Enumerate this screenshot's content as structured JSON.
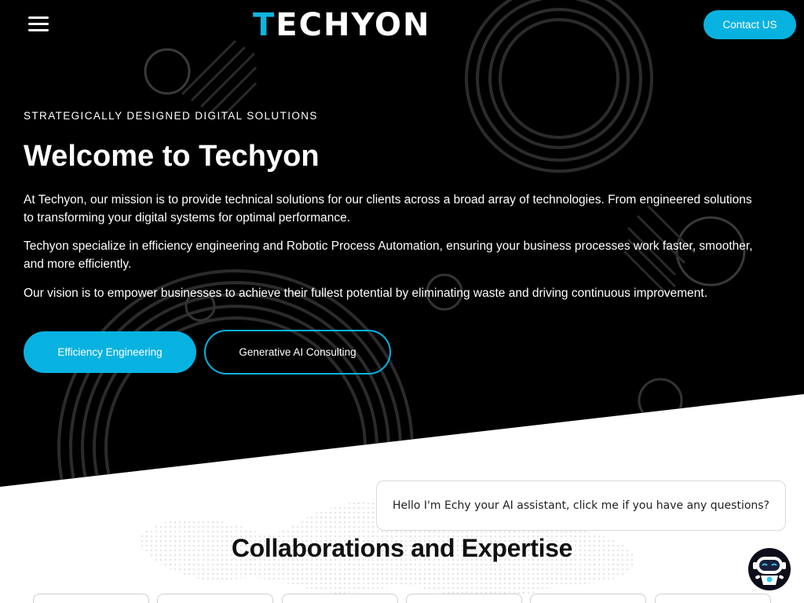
{
  "header": {
    "menu_icon": "hamburger-menu-icon",
    "logo_accent": "T",
    "logo_rest": "ECHYON",
    "contact_label": "Contact US"
  },
  "hero": {
    "eyebrow": "STRATEGICALLY DESIGNED DIGITAL SOLUTIONS",
    "title": "Welcome to Techyon",
    "paragraphs": [
      "At Techyon, our mission is to provide technical solutions for  our clients across a broad array of technologies.  From engineered solutions to transforming your digital systems for optimal performance.",
      "Techyon specialize in efficiency engineering and Robotic Process Automation, ensuring your business processes work faster, smoother, and more efficiently.",
      "Our vision is to empower businesses to achieve their fullest potential by eliminating waste and driving continuous improvement."
    ],
    "primary_button": "Efficiency Engineering",
    "secondary_button": "Generative AI Consulting"
  },
  "section": {
    "title": "Collaborations and Expertise"
  },
  "chat": {
    "bubble_text": "Hello I'm Echy your AI assistant, click me if you have any questions?",
    "bot_icon": "chatbot-avatar-icon"
  },
  "colors": {
    "accent": "#08b2e0",
    "hero_bg": "#000000",
    "text_dark": "#111111"
  }
}
